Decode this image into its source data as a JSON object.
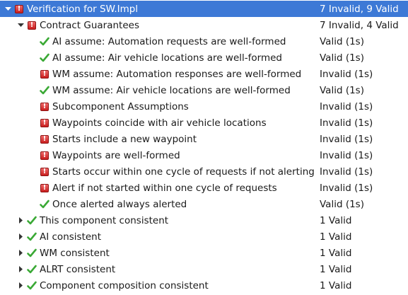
{
  "rows": [
    {
      "level": 0,
      "expander": "expanded",
      "icon": "error-icon",
      "label": "Verification for SW.Impl",
      "status": "7 Invalid, 9 Valid",
      "selected": true
    },
    {
      "level": 1,
      "expander": "expanded",
      "icon": "error-icon",
      "label": "Contract Guarantees",
      "status": "7 Invalid, 4 Valid"
    },
    {
      "level": 2,
      "expander": "none",
      "icon": "check-icon",
      "label": "AI assume: Automation requests are well-formed",
      "status": "Valid (1s)"
    },
    {
      "level": 2,
      "expander": "none",
      "icon": "check-icon",
      "label": "AI assume: Air vehicle locations are well-formed",
      "status": "Valid (1s)"
    },
    {
      "level": 2,
      "expander": "none",
      "icon": "error-icon",
      "label": "WM assume: Automation responses are well-formed",
      "status": "Invalid (1s)"
    },
    {
      "level": 2,
      "expander": "none",
      "icon": "check-icon",
      "label": "WM assume: Air vehicle locations are well-formed",
      "status": "Valid (1s)"
    },
    {
      "level": 2,
      "expander": "none",
      "icon": "error-icon",
      "label": "Subcomponent Assumptions",
      "status": "Invalid (1s)"
    },
    {
      "level": 2,
      "expander": "none",
      "icon": "error-icon",
      "label": "Waypoints coincide with air vehicle locations",
      "status": "Invalid (1s)"
    },
    {
      "level": 2,
      "expander": "none",
      "icon": "error-icon",
      "label": "Starts include a new waypoint",
      "status": "Invalid (1s)"
    },
    {
      "level": 2,
      "expander": "none",
      "icon": "error-icon",
      "label": "Waypoints are well-formed",
      "status": "Invalid (1s)"
    },
    {
      "level": 2,
      "expander": "none",
      "icon": "error-icon",
      "label": "Starts occur within one cycle of requests if not alerting",
      "status": "Invalid (1s)"
    },
    {
      "level": 2,
      "expander": "none",
      "icon": "error-icon",
      "label": "Alert if not started within one cycle of requests",
      "status": "Invalid (1s)"
    },
    {
      "level": 2,
      "expander": "none",
      "icon": "check-icon",
      "label": "Once alerted always alerted",
      "status": "Valid (1s)"
    },
    {
      "level": 1,
      "expander": "collapsed",
      "icon": "check-icon",
      "label": "This component consistent",
      "status": "1 Valid"
    },
    {
      "level": 1,
      "expander": "collapsed",
      "icon": "check-icon",
      "label": "AI consistent",
      "status": "1 Valid"
    },
    {
      "level": 1,
      "expander": "collapsed",
      "icon": "check-icon",
      "label": "WM consistent",
      "status": "1 Valid"
    },
    {
      "level": 1,
      "expander": "collapsed",
      "icon": "check-icon",
      "label": "ALRT consistent",
      "status": "1 Valid"
    },
    {
      "level": 1,
      "expander": "collapsed",
      "icon": "check-icon",
      "label": "Component composition consistent",
      "status": "1 Valid"
    }
  ],
  "colors": {
    "selection": "#3d79d6",
    "error": "#d62828",
    "valid": "#3aa935"
  }
}
